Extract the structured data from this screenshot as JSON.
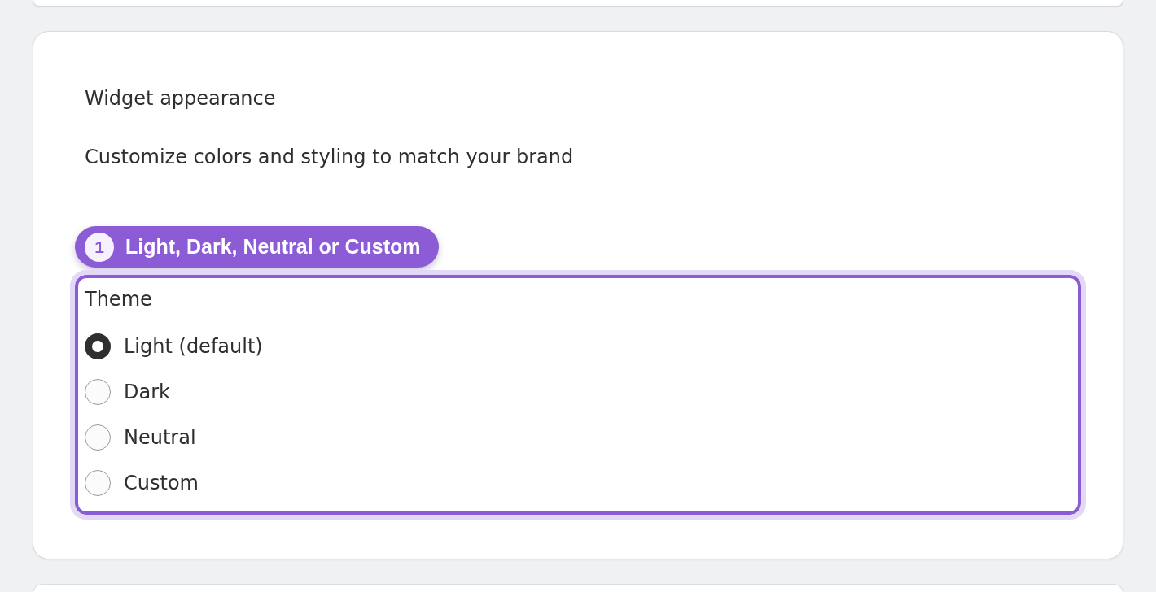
{
  "card": {
    "title": "Widget appearance",
    "description": "Customize colors and styling to match your brand"
  },
  "annotation": {
    "number": "1",
    "label": "Light, Dark, Neutral or Custom"
  },
  "theme": {
    "legend": "Theme",
    "options": [
      {
        "label": "Light (default)",
        "selected": true
      },
      {
        "label": "Dark",
        "selected": false
      },
      {
        "label": "Neutral",
        "selected": false
      },
      {
        "label": "Custom",
        "selected": false
      }
    ]
  }
}
